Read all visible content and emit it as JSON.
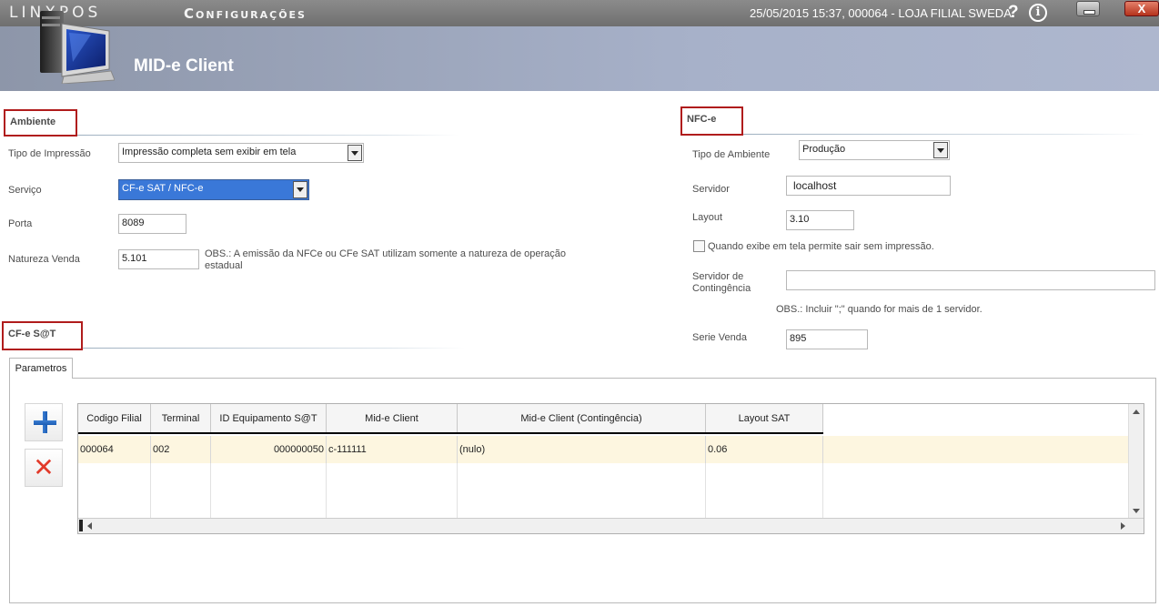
{
  "titlebar": {
    "brand": "LINXPOS",
    "module": "Configurações",
    "status": "25/05/2015 15:37, 000064 - LOJA FILIAL SWEDA.",
    "help_glyph": "?",
    "info_glyph": "i",
    "close_glyph": "X"
  },
  "header": {
    "title": "MID-e Client",
    "icon": "computer-monitor-icon"
  },
  "ambiente": {
    "title": "Ambiente",
    "tipo_impressao_label": "Tipo de Impressão",
    "tipo_impressao_value": "Impressão completa sem exibir em tela",
    "servico_label": "Serviço",
    "servico_value": "CF-e SAT  /  NFC-e",
    "porta_label": "Porta",
    "porta_value": "8089",
    "natureza_label": "Natureza Venda",
    "natureza_value": "5.101",
    "obs": "OBS.: A emissão da NFCe ou CFe SAT utilizam somente a natureza de operação estadual"
  },
  "nfce": {
    "title": "NFC-e",
    "tipo_ambiente_label": "Tipo de Ambiente",
    "tipo_ambiente_value": "Produção",
    "servidor_label": "Servidor",
    "servidor_value": "localhost",
    "layout_label": "Layout",
    "layout_value": "3.10",
    "checkbox_label": "Quando exibe em tela permite sair sem impressão.",
    "contingencia_label": "Servidor de Contingência",
    "contingencia_value": "",
    "obs": "OBS.: Incluir \";\" quando for mais de 1 servidor.",
    "serie_label": "Serie Venda",
    "serie_value": "895"
  },
  "cfesat": {
    "title": "CF-e S@T",
    "tab_label": "Parametros",
    "grid": {
      "columns": [
        "Codigo Filial",
        "Terminal",
        "ID Equipamento S@T",
        "Mid-e Client",
        "Mid-e Client (Contingência)",
        "Layout SAT"
      ],
      "rows": [
        [
          "000064",
          "002",
          "000000050",
          "c-111111",
          "(nulo)",
          "0.06"
        ]
      ]
    }
  },
  "colors": {
    "accent_red": "#b01c1c",
    "row_highlight": "#fdf6e0",
    "select_blue": "#3a78d8"
  }
}
